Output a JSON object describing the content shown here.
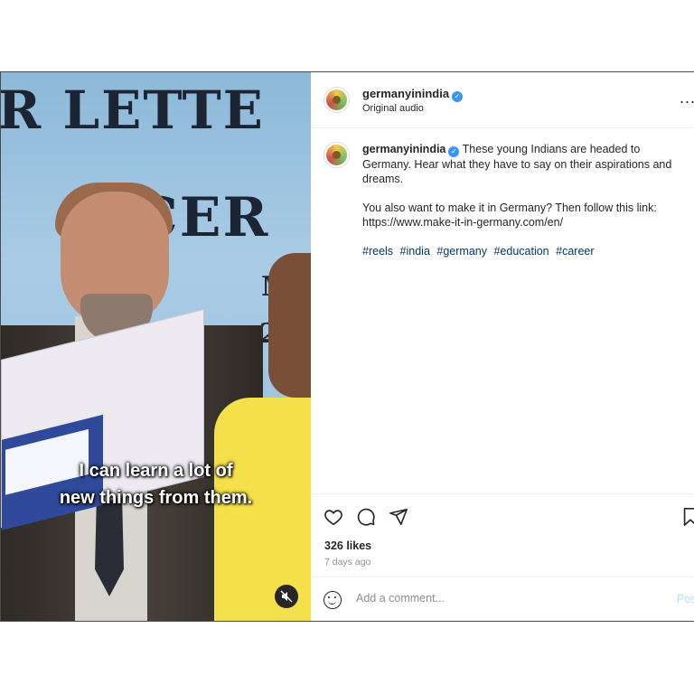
{
  "video": {
    "banner_line1": "R LETTE",
    "banner_line2": "CER",
    "banner_line3": "M",
    "banner_line4": "20",
    "subtitle_line1": "I can learn a lot of",
    "subtitle_line2": "new things from them.",
    "mute_icon": "speaker-muted-icon"
  },
  "post": {
    "username": "germanyinindia",
    "verified_icon": "✓",
    "audio_label": "Original audio",
    "more_label": "...",
    "caption": {
      "username": "germanyinindia",
      "text1": "These young Indians are headed to Germany. Hear what they have to say on their aspirations and dreams.",
      "text2": "You also want to make it in Germany? Then follow this link: https://www.make-it-in-germany.com/en/",
      "hashtags": [
        "#reels",
        "#india",
        "#germany",
        "#education",
        "#career"
      ]
    },
    "likes": "326 likes",
    "time": "7 days ago",
    "comment_placeholder": "Add a comment...",
    "post_button": "Post"
  },
  "colors": {
    "link": "#00376b",
    "verified": "#3897f0",
    "post_button": "#b2dffc"
  }
}
